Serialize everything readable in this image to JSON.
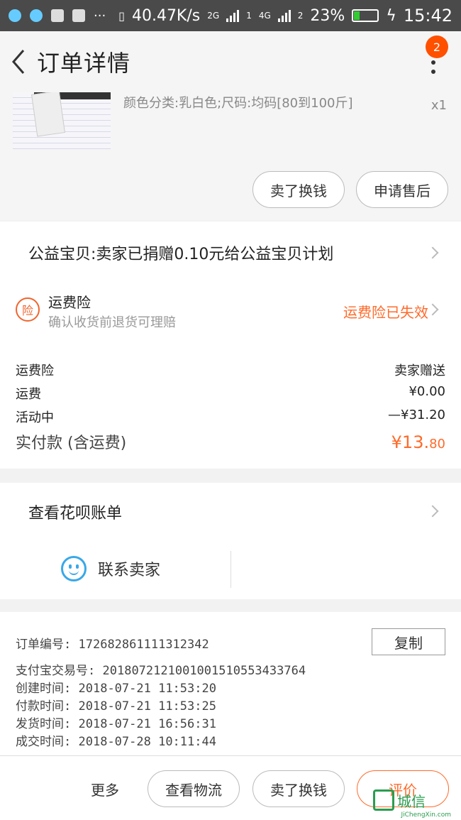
{
  "status_bar": {
    "net_speed": "40.47K/s",
    "net_2g": "2G",
    "net_4g": "4G",
    "sim1": "1",
    "sim2": "2",
    "battery": "23%",
    "time": "15:42",
    "icons": [
      "headset-icon",
      "wechat-icon",
      "apps-icon",
      "image-icon",
      "more-icon",
      "vibrate-icon",
      "signal-icon",
      "battery-icon",
      "charging-icon"
    ]
  },
  "header": {
    "title": "订单详情",
    "badge_count": "2"
  },
  "product": {
    "sku": "颜色分类:乳白色;尺码:均码[80到100斤]",
    "qty": "x1",
    "actions": {
      "sell": "卖了换钱",
      "aftersale": "申请售后"
    }
  },
  "charity": {
    "text": "公益宝贝:卖家已捐赠0.10元给公益宝贝计划"
  },
  "insurance": {
    "icon_text": "险",
    "title": "运费险",
    "subtitle": "确认收货前退货可理赔",
    "status": "运费险已失效",
    "accent": "#ff6a2a"
  },
  "fees": [
    {
      "label": "运费险",
      "value": "卖家赠送"
    },
    {
      "label": "运费",
      "value": "¥0.00"
    },
    {
      "label": "活动中",
      "value": "—¥31.20"
    }
  ],
  "total": {
    "label": "实付款 (含运费)",
    "amount_main": "¥13.",
    "amount_cents": "80"
  },
  "huabei": {
    "label": "查看花呗账单"
  },
  "contact": {
    "label": "联系卖家"
  },
  "order_info": {
    "copy_label": "复制",
    "rows": [
      {
        "label": "订单编号:",
        "value": "172682861111312342"
      },
      {
        "label": "支付宝交易号:",
        "value": "2018072121001001510553433764"
      },
      {
        "label": "创建时间:",
        "value": "2018-07-21 11:53:20"
      },
      {
        "label": "付款时间:",
        "value": "2018-07-21 11:53:25"
      },
      {
        "label": "发货时间:",
        "value": "2018-07-21 16:56:31"
      },
      {
        "label": "成交时间:",
        "value": "2018-07-28 10:11:44"
      }
    ]
  },
  "bottom_bar": {
    "more": "更多",
    "logistics": "查看物流",
    "sell": "卖了换钱",
    "review": "评价"
  },
  "watermark": {
    "text": "城信",
    "sub": "JiChengXin.com"
  }
}
